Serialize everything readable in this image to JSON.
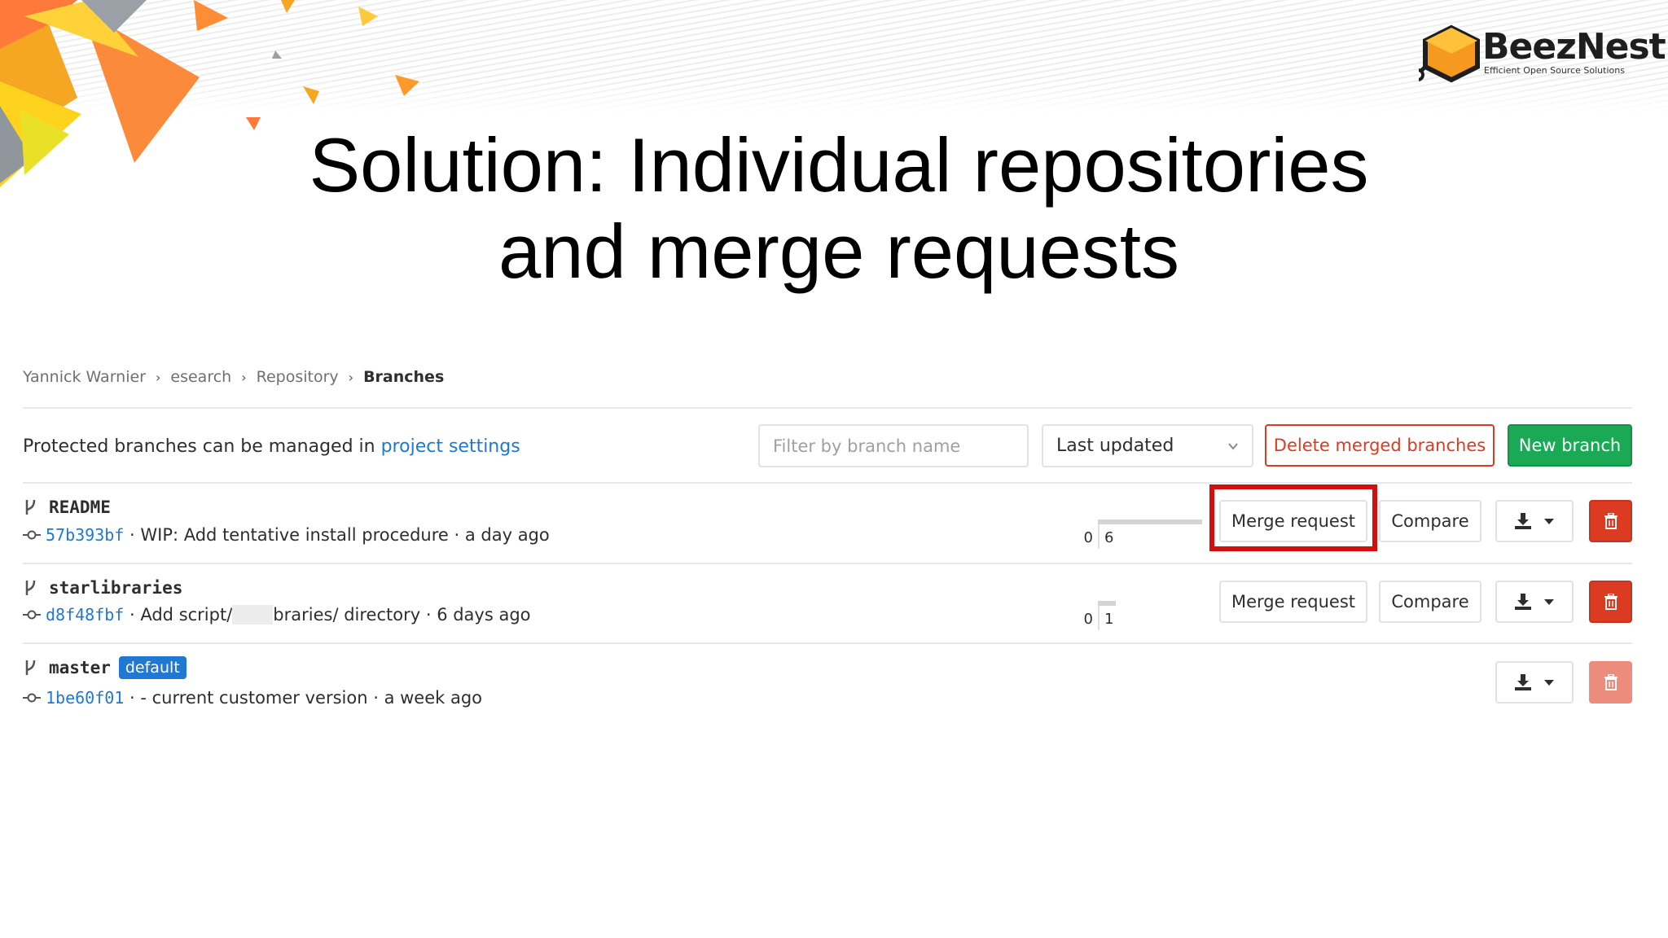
{
  "slide": {
    "title_line1": "Solution: Individual repositories",
    "title_line2": "and merge requests"
  },
  "logo": {
    "name": "BeezNest",
    "tagline": "Efficient Open Source Solutions"
  },
  "breadcrumb": {
    "items": [
      "Yannick Warnier",
      "esearch",
      "Repository"
    ],
    "current": "Branches"
  },
  "toolbar": {
    "info_text": "Protected branches can be managed in ",
    "info_link": "project settings",
    "filter_placeholder": "Filter by branch name",
    "sort_value": "Last updated",
    "delete_merged_label": "Delete merged branches",
    "new_branch_label": "New branch"
  },
  "branches": [
    {
      "name": "README",
      "default": false,
      "sha": "57b393bf",
      "message": "WIP: Add tentative install procedure",
      "time": "a day ago",
      "behind": "0",
      "ahead": "6",
      "merge_request_label": "Merge request",
      "compare_label": "Compare"
    },
    {
      "name": "starlibraries",
      "default": false,
      "sha": "d8f48fbf",
      "message_start": "Add script/",
      "message_end": "braries/ directory",
      "time": "6 days ago",
      "behind": "0",
      "ahead": "1",
      "merge_request_label": "Merge request",
      "compare_label": "Compare"
    },
    {
      "name": "master",
      "default": true,
      "default_label": "default",
      "sha": "1be60f01",
      "message": "- current customer version",
      "time": "a week ago"
    }
  ],
  "colors": {
    "link": "#1f78d1",
    "success": "#1aaa55",
    "danger": "#db3b21",
    "highlight": "#d20f0f"
  },
  "icons": {
    "branch": "branch-icon",
    "commit": "commit-icon",
    "download": "download-icon",
    "caret": "caret-down-icon",
    "trash": "trash-icon",
    "chevron": "chevron-down-icon"
  }
}
